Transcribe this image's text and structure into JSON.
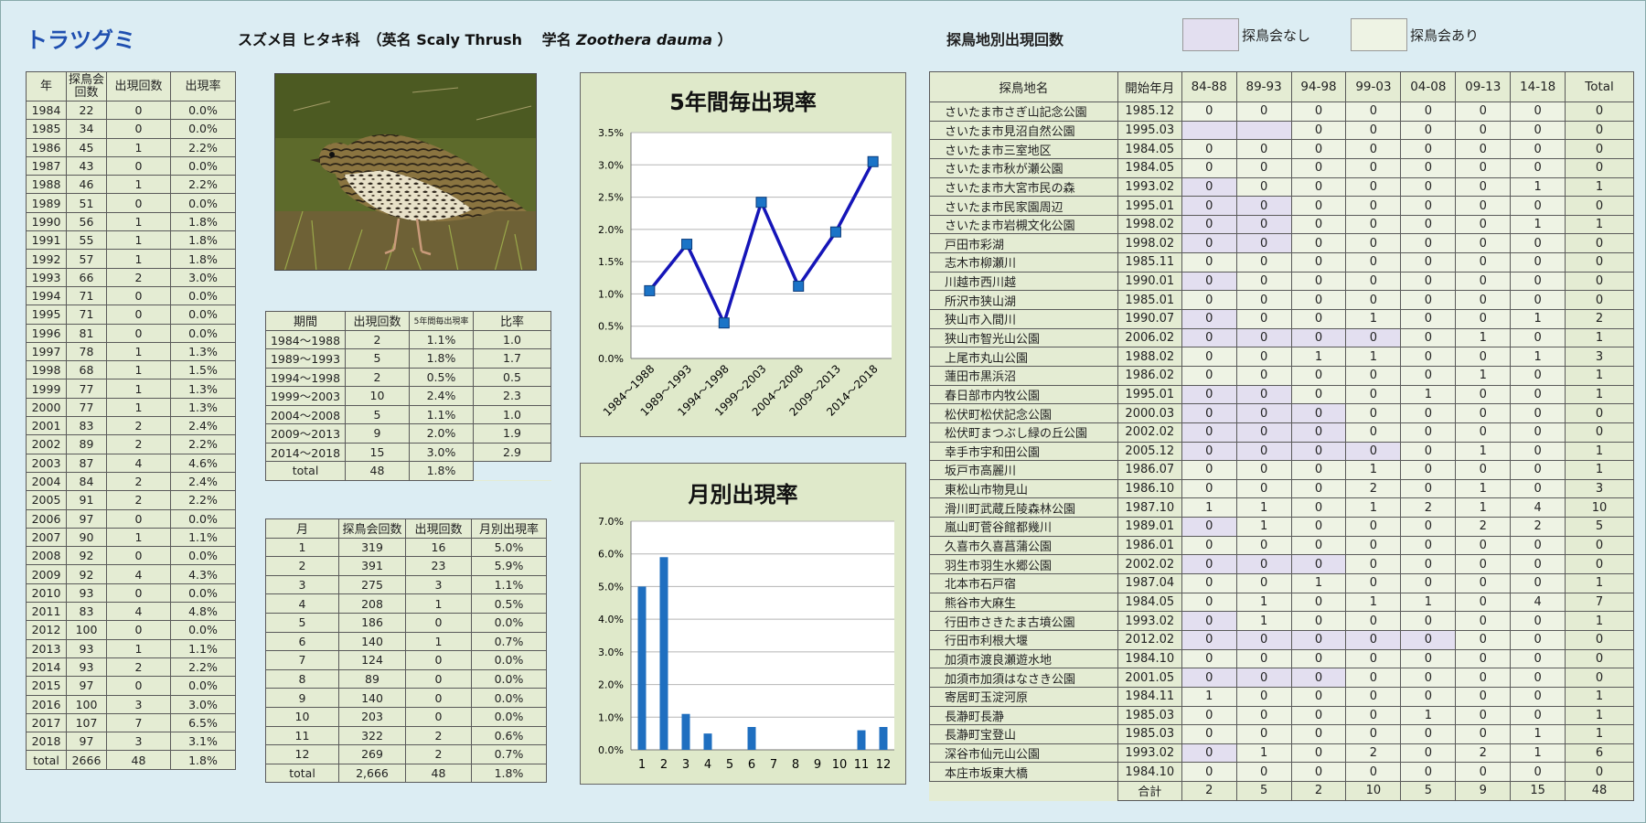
{
  "header": {
    "title": "トラツグミ",
    "order": "スズメ目 ヒタキ科",
    "en_label": "（英名",
    "en_name": "Scaly Thrush",
    "sci_label": "学名",
    "sci_name": "Zoothera dauma",
    "close_paren": "）"
  },
  "site_section": {
    "title": "探鳥地別出現回数",
    "legend_no_event": "探鳥会なし",
    "legend_event": "探鳥会あり",
    "colors": {
      "no_event": "#e3dff0",
      "event": "#eef3e4"
    }
  },
  "year_table": {
    "headers": [
      "年",
      "探鳥会回数",
      "出現回数",
      "出現率"
    ],
    "rows": [
      [
        "1984",
        "22",
        "0",
        "0.0%"
      ],
      [
        "1985",
        "34",
        "0",
        "0.0%"
      ],
      [
        "1986",
        "45",
        "1",
        "2.2%"
      ],
      [
        "1987",
        "43",
        "0",
        "0.0%"
      ],
      [
        "1988",
        "46",
        "1",
        "2.2%"
      ],
      [
        "1989",
        "51",
        "0",
        "0.0%"
      ],
      [
        "1990",
        "56",
        "1",
        "1.8%"
      ],
      [
        "1991",
        "55",
        "1",
        "1.8%"
      ],
      [
        "1992",
        "57",
        "1",
        "1.8%"
      ],
      [
        "1993",
        "66",
        "2",
        "3.0%"
      ],
      [
        "1994",
        "71",
        "0",
        "0.0%"
      ],
      [
        "1995",
        "71",
        "0",
        "0.0%"
      ],
      [
        "1996",
        "81",
        "0",
        "0.0%"
      ],
      [
        "1997",
        "78",
        "1",
        "1.3%"
      ],
      [
        "1998",
        "68",
        "1",
        "1.5%"
      ],
      [
        "1999",
        "77",
        "1",
        "1.3%"
      ],
      [
        "2000",
        "77",
        "1",
        "1.3%"
      ],
      [
        "2001",
        "83",
        "2",
        "2.4%"
      ],
      [
        "2002",
        "89",
        "2",
        "2.2%"
      ],
      [
        "2003",
        "87",
        "4",
        "4.6%"
      ],
      [
        "2004",
        "84",
        "2",
        "2.4%"
      ],
      [
        "2005",
        "91",
        "2",
        "2.2%"
      ],
      [
        "2006",
        "97",
        "0",
        "0.0%"
      ],
      [
        "2007",
        "90",
        "1",
        "1.1%"
      ],
      [
        "2008",
        "92",
        "0",
        "0.0%"
      ],
      [
        "2009",
        "92",
        "4",
        "4.3%"
      ],
      [
        "2010",
        "93",
        "0",
        "0.0%"
      ],
      [
        "2011",
        "83",
        "4",
        "4.8%"
      ],
      [
        "2012",
        "100",
        "0",
        "0.0%"
      ],
      [
        "2013",
        "93",
        "1",
        "1.1%"
      ],
      [
        "2014",
        "93",
        "2",
        "2.2%"
      ],
      [
        "2015",
        "97",
        "0",
        "0.0%"
      ],
      [
        "2016",
        "100",
        "3",
        "3.0%"
      ],
      [
        "2017",
        "107",
        "7",
        "6.5%"
      ],
      [
        "2018",
        "97",
        "3",
        "3.1%"
      ],
      [
        "total",
        "2666",
        "48",
        "1.8%"
      ]
    ]
  },
  "period_table": {
    "headers": [
      "期間",
      "出現回数",
      "5年間毎出現率",
      "比率"
    ],
    "rows": [
      [
        "1984～1988",
        "2",
        "1.1%",
        "1.0"
      ],
      [
        "1989～1993",
        "5",
        "1.8%",
        "1.7"
      ],
      [
        "1994～1998",
        "2",
        "0.5%",
        "0.5"
      ],
      [
        "1999～2003",
        "10",
        "2.4%",
        "2.3"
      ],
      [
        "2004～2008",
        "5",
        "1.1%",
        "1.0"
      ],
      [
        "2009～2013",
        "9",
        "2.0%",
        "1.9"
      ],
      [
        "2014～2018",
        "15",
        "3.0%",
        "2.9"
      ]
    ],
    "total": [
      "total",
      "48",
      "1.8%"
    ]
  },
  "month_table": {
    "headers": [
      "月",
      "探鳥会回数",
      "出現回数",
      "月別出現率"
    ],
    "rows": [
      [
        "1",
        "319",
        "16",
        "5.0%"
      ],
      [
        "2",
        "391",
        "23",
        "5.9%"
      ],
      [
        "3",
        "275",
        "3",
        "1.1%"
      ],
      [
        "4",
        "208",
        "1",
        "0.5%"
      ],
      [
        "5",
        "186",
        "0",
        "0.0%"
      ],
      [
        "6",
        "140",
        "1",
        "0.7%"
      ],
      [
        "7",
        "124",
        "0",
        "0.0%"
      ],
      [
        "8",
        "89",
        "0",
        "0.0%"
      ],
      [
        "9",
        "140",
        "0",
        "0.0%"
      ],
      [
        "10",
        "203",
        "0",
        "0.0%"
      ],
      [
        "11",
        "322",
        "2",
        "0.6%"
      ],
      [
        "12",
        "269",
        "2",
        "0.7%"
      ],
      [
        "total",
        "2,666",
        "48",
        "1.8%"
      ]
    ]
  },
  "site_table": {
    "headers": [
      "探鳥地名",
      "開始年月",
      "84-88",
      "89-93",
      "94-98",
      "99-03",
      "04-08",
      "09-13",
      "14-18",
      "Total"
    ],
    "rows": [
      {
        "name": "さいたま市さぎ山記念公園",
        "start": "1985.12",
        "vals": [
          "0",
          "0",
          "0",
          "0",
          "0",
          "0",
          "0",
          "0"
        ],
        "flags": [
          0,
          0,
          0,
          0,
          0,
          0,
          0
        ]
      },
      {
        "name": "さいたま市見沼自然公園",
        "start": "1995.03",
        "vals": [
          "",
          "",
          "0",
          "0",
          "0",
          "0",
          "0",
          "0"
        ],
        "flags": [
          1,
          1,
          0,
          0,
          0,
          0,
          0
        ]
      },
      {
        "name": "さいたま市三室地区",
        "start": "1984.05",
        "vals": [
          "0",
          "0",
          "0",
          "0",
          "0",
          "0",
          "0",
          "0"
        ],
        "flags": [
          0,
          0,
          0,
          0,
          0,
          0,
          0
        ]
      },
      {
        "name": "さいたま市秋が瀬公園",
        "start": "1984.05",
        "vals": [
          "0",
          "0",
          "0",
          "0",
          "0",
          "0",
          "0",
          "0"
        ],
        "flags": [
          0,
          0,
          0,
          0,
          0,
          0,
          0
        ]
      },
      {
        "name": "さいたま市大宮市民の森",
        "start": "1993.02",
        "vals": [
          "0",
          "0",
          "0",
          "0",
          "0",
          "0",
          "1",
          "1"
        ],
        "flags": [
          1,
          0,
          0,
          0,
          0,
          0,
          0
        ]
      },
      {
        "name": "さいたま市民家園周辺",
        "start": "1995.01",
        "vals": [
          "0",
          "0",
          "0",
          "0",
          "0",
          "0",
          "0",
          "0"
        ],
        "flags": [
          1,
          1,
          0,
          0,
          0,
          0,
          0
        ]
      },
      {
        "name": "さいたま市岩槻文化公園",
        "start": "1998.02",
        "vals": [
          "0",
          "0",
          "0",
          "0",
          "0",
          "0",
          "1",
          "1"
        ],
        "flags": [
          1,
          1,
          0,
          0,
          0,
          0,
          0
        ]
      },
      {
        "name": "戸田市彩湖",
        "start": "1998.02",
        "vals": [
          "0",
          "0",
          "0",
          "0",
          "0",
          "0",
          "0",
          "0"
        ],
        "flags": [
          1,
          1,
          0,
          0,
          0,
          0,
          0
        ]
      },
      {
        "name": "志木市柳瀬川",
        "start": "1985.11",
        "vals": [
          "0",
          "0",
          "0",
          "0",
          "0",
          "0",
          "0",
          "0"
        ],
        "flags": [
          0,
          0,
          0,
          0,
          0,
          0,
          0
        ]
      },
      {
        "name": "川越市西川越",
        "start": "1990.01",
        "vals": [
          "0",
          "0",
          "0",
          "0",
          "0",
          "0",
          "0",
          "0"
        ],
        "flags": [
          1,
          0,
          0,
          0,
          0,
          0,
          0
        ]
      },
      {
        "name": "所沢市狭山湖",
        "start": "1985.01",
        "vals": [
          "0",
          "0",
          "0",
          "0",
          "0",
          "0",
          "0",
          "0"
        ],
        "flags": [
          0,
          0,
          0,
          0,
          0,
          0,
          0
        ]
      },
      {
        "name": "狭山市入間川",
        "start": "1990.07",
        "vals": [
          "0",
          "0",
          "0",
          "1",
          "0",
          "0",
          "1",
          "2"
        ],
        "flags": [
          1,
          0,
          0,
          0,
          0,
          0,
          0
        ]
      },
      {
        "name": "狭山市智光山公園",
        "start": "2006.02",
        "vals": [
          "0",
          "0",
          "0",
          "0",
          "0",
          "1",
          "0",
          "1"
        ],
        "flags": [
          1,
          1,
          1,
          1,
          0,
          0,
          0
        ]
      },
      {
        "name": "上尾市丸山公園",
        "start": "1988.02",
        "vals": [
          "0",
          "0",
          "1",
          "1",
          "0",
          "0",
          "1",
          "3"
        ],
        "flags": [
          0,
          0,
          0,
          0,
          0,
          0,
          0
        ]
      },
      {
        "name": "蓮田市黒浜沼",
        "start": "1986.02",
        "vals": [
          "0",
          "0",
          "0",
          "0",
          "0",
          "1",
          "0",
          "1"
        ],
        "flags": [
          0,
          0,
          0,
          0,
          0,
          0,
          0
        ]
      },
      {
        "name": "春日部市内牧公園",
        "start": "1995.01",
        "vals": [
          "0",
          "0",
          "0",
          "0",
          "1",
          "0",
          "0",
          "1"
        ],
        "flags": [
          1,
          1,
          0,
          0,
          0,
          0,
          0
        ]
      },
      {
        "name": "松伏町松伏記念公園",
        "start": "2000.03",
        "vals": [
          "0",
          "0",
          "0",
          "0",
          "0",
          "0",
          "0",
          "0"
        ],
        "flags": [
          1,
          1,
          1,
          0,
          0,
          0,
          0
        ]
      },
      {
        "name": "松伏町まつぶし緑の丘公園",
        "start": "2002.02",
        "vals": [
          "0",
          "0",
          "0",
          "0",
          "0",
          "0",
          "0",
          "0"
        ],
        "flags": [
          1,
          1,
          1,
          0,
          0,
          0,
          0
        ]
      },
      {
        "name": "幸手市宇和田公園",
        "start": "2005.12",
        "vals": [
          "0",
          "0",
          "0",
          "0",
          "0",
          "1",
          "0",
          "1"
        ],
        "flags": [
          1,
          1,
          1,
          1,
          0,
          0,
          0
        ]
      },
      {
        "name": "坂戸市高麗川",
        "start": "1986.07",
        "vals": [
          "0",
          "0",
          "0",
          "1",
          "0",
          "0",
          "0",
          "1"
        ],
        "flags": [
          0,
          0,
          0,
          0,
          0,
          0,
          0
        ]
      },
      {
        "name": "東松山市物見山",
        "start": "1986.10",
        "vals": [
          "0",
          "0",
          "0",
          "2",
          "0",
          "1",
          "0",
          "3"
        ],
        "flags": [
          0,
          0,
          0,
          0,
          0,
          0,
          0
        ]
      },
      {
        "name": "滑川町武蔵丘陵森林公園",
        "start": "1987.10",
        "vals": [
          "1",
          "1",
          "0",
          "1",
          "2",
          "1",
          "4",
          "10"
        ],
        "flags": [
          0,
          0,
          0,
          0,
          0,
          0,
          0
        ]
      },
      {
        "name": "嵐山町菅谷館都幾川",
        "start": "1989.01",
        "vals": [
          "0",
          "1",
          "0",
          "0",
          "0",
          "2",
          "2",
          "5"
        ],
        "flags": [
          1,
          0,
          0,
          0,
          0,
          0,
          0
        ]
      },
      {
        "name": "久喜市久喜菖蒲公園",
        "start": "1986.01",
        "vals": [
          "0",
          "0",
          "0",
          "0",
          "0",
          "0",
          "0",
          "0"
        ],
        "flags": [
          0,
          0,
          0,
          0,
          0,
          0,
          0
        ]
      },
      {
        "name": "羽生市羽生水郷公園",
        "start": "2002.02",
        "vals": [
          "0",
          "0",
          "0",
          "0",
          "0",
          "0",
          "0",
          "0"
        ],
        "flags": [
          1,
          1,
          1,
          0,
          0,
          0,
          0
        ]
      },
      {
        "name": "北本市石戸宿",
        "start": "1987.04",
        "vals": [
          "0",
          "0",
          "1",
          "0",
          "0",
          "0",
          "0",
          "1"
        ],
        "flags": [
          0,
          0,
          0,
          0,
          0,
          0,
          0
        ]
      },
      {
        "name": "熊谷市大麻生",
        "start": "1984.05",
        "vals": [
          "0",
          "1",
          "0",
          "1",
          "1",
          "0",
          "4",
          "7"
        ],
        "flags": [
          0,
          0,
          0,
          0,
          0,
          0,
          0
        ]
      },
      {
        "name": "行田市さきたま古墳公園",
        "start": "1993.02",
        "vals": [
          "0",
          "1",
          "0",
          "0",
          "0",
          "0",
          "0",
          "1"
        ],
        "flags": [
          1,
          0,
          0,
          0,
          0,
          0,
          0
        ]
      },
      {
        "name": "行田市利根大堰",
        "start": "2012.02",
        "vals": [
          "0",
          "0",
          "0",
          "0",
          "0",
          "0",
          "0",
          "0"
        ],
        "flags": [
          1,
          1,
          1,
          1,
          1,
          0,
          0
        ]
      },
      {
        "name": "加須市渡良瀬遊水地",
        "start": "1984.10",
        "vals": [
          "0",
          "0",
          "0",
          "0",
          "0",
          "0",
          "0",
          "0"
        ],
        "flags": [
          0,
          0,
          0,
          0,
          0,
          0,
          0
        ]
      },
      {
        "name": "加須市加須はなさき公園",
        "start": "2001.05",
        "vals": [
          "0",
          "0",
          "0",
          "0",
          "0",
          "0",
          "0",
          "0"
        ],
        "flags": [
          1,
          1,
          1,
          0,
          0,
          0,
          0
        ]
      },
      {
        "name": "寄居町玉淀河原",
        "start": "1984.11",
        "vals": [
          "1",
          "0",
          "0",
          "0",
          "0",
          "0",
          "0",
          "1"
        ],
        "flags": [
          0,
          0,
          0,
          0,
          0,
          0,
          0
        ]
      },
      {
        "name": "長瀞町長瀞",
        "start": "1985.03",
        "vals": [
          "0",
          "0",
          "0",
          "0",
          "1",
          "0",
          "0",
          "1"
        ],
        "flags": [
          0,
          0,
          0,
          0,
          0,
          0,
          0
        ]
      },
      {
        "name": "長瀞町宝登山",
        "start": "1985.03",
        "vals": [
          "0",
          "0",
          "0",
          "0",
          "0",
          "0",
          "1",
          "1"
        ],
        "flags": [
          0,
          0,
          0,
          0,
          0,
          0,
          0
        ]
      },
      {
        "name": "深谷市仙元山公園",
        "start": "1993.02",
        "vals": [
          "0",
          "1",
          "0",
          "2",
          "0",
          "2",
          "1",
          "6"
        ],
        "flags": [
          1,
          0,
          0,
          0,
          0,
          0,
          0
        ]
      },
      {
        "name": "本庄市坂東大橋",
        "start": "1984.10",
        "vals": [
          "0",
          "0",
          "0",
          "0",
          "0",
          "0",
          "0",
          "0"
        ],
        "flags": [
          0,
          0,
          0,
          0,
          0,
          0,
          0
        ]
      }
    ],
    "total_label": "合計",
    "totals": [
      "2",
      "5",
      "2",
      "10",
      "5",
      "9",
      "15",
      "48"
    ]
  },
  "chart_data": [
    {
      "type": "line",
      "title": "5年間毎出現率",
      "categories": [
        "1984～1988",
        "1989～1993",
        "1994～1998",
        "1999～2003",
        "2004～2008",
        "2009～2013",
        "2014～2018"
      ],
      "values": [
        1.05,
        1.77,
        0.55,
        2.42,
        1.12,
        1.96,
        3.05
      ],
      "ylim": [
        0,
        3.5
      ],
      "yticks": [
        "0.0%",
        "0.5%",
        "1.0%",
        "1.5%",
        "2.0%",
        "2.5%",
        "3.0%",
        "3.5%"
      ],
      "grid": true,
      "color": "#1515b8",
      "marker_color": "#1b74c7"
    },
    {
      "type": "bar",
      "title": "月別出現率",
      "categories": [
        "1",
        "2",
        "3",
        "4",
        "5",
        "6",
        "7",
        "8",
        "9",
        "10",
        "11",
        "12"
      ],
      "values": [
        5.0,
        5.9,
        1.1,
        0.5,
        0.0,
        0.7,
        0.0,
        0.0,
        0.0,
        0.0,
        0.6,
        0.7
      ],
      "ylim": [
        0,
        7.0
      ],
      "yticks": [
        "0.0%",
        "1.0%",
        "2.0%",
        "3.0%",
        "4.0%",
        "5.0%",
        "6.0%",
        "7.0%"
      ],
      "grid": true,
      "color": "#1f6fc0"
    }
  ]
}
